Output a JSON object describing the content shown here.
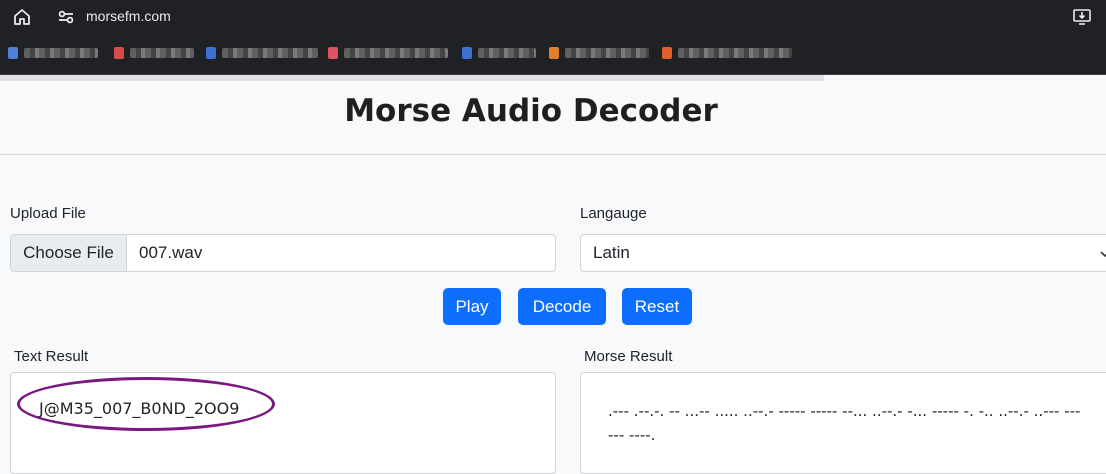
{
  "browser": {
    "url": "morsefm.com",
    "bookmarks": [
      {
        "color": "#4f7fd6"
      },
      {
        "color": "#d64b4b"
      },
      {
        "color": "#3f6fd0"
      },
      {
        "color": "#d9545e"
      },
      {
        "color": "#3f6fd0"
      },
      {
        "color": "#e0802c"
      },
      {
        "color": "#e0602c"
      }
    ]
  },
  "page": {
    "title": "Morse Audio Decoder",
    "upload": {
      "label": "Upload File",
      "choose_label": "Choose File",
      "file_name": "007.wav"
    },
    "language": {
      "label": "Langauge",
      "selected": "Latin"
    },
    "buttons": {
      "play": "Play",
      "decode": "Decode",
      "reset": "Reset"
    },
    "text_result": {
      "label": "Text Result",
      "value": "J@M35_007_B0ND_2OO9"
    },
    "morse_result": {
      "label": "Morse Result",
      "value": ".--- .--.-. -- ...-- ..... ..--.- ----- ----- --... ..--.- -... ----- -. -.. ..--.- ..--- --- --- ----."
    }
  },
  "colors": {
    "accent": "#0d6efd",
    "highlight": "#7b1880"
  }
}
